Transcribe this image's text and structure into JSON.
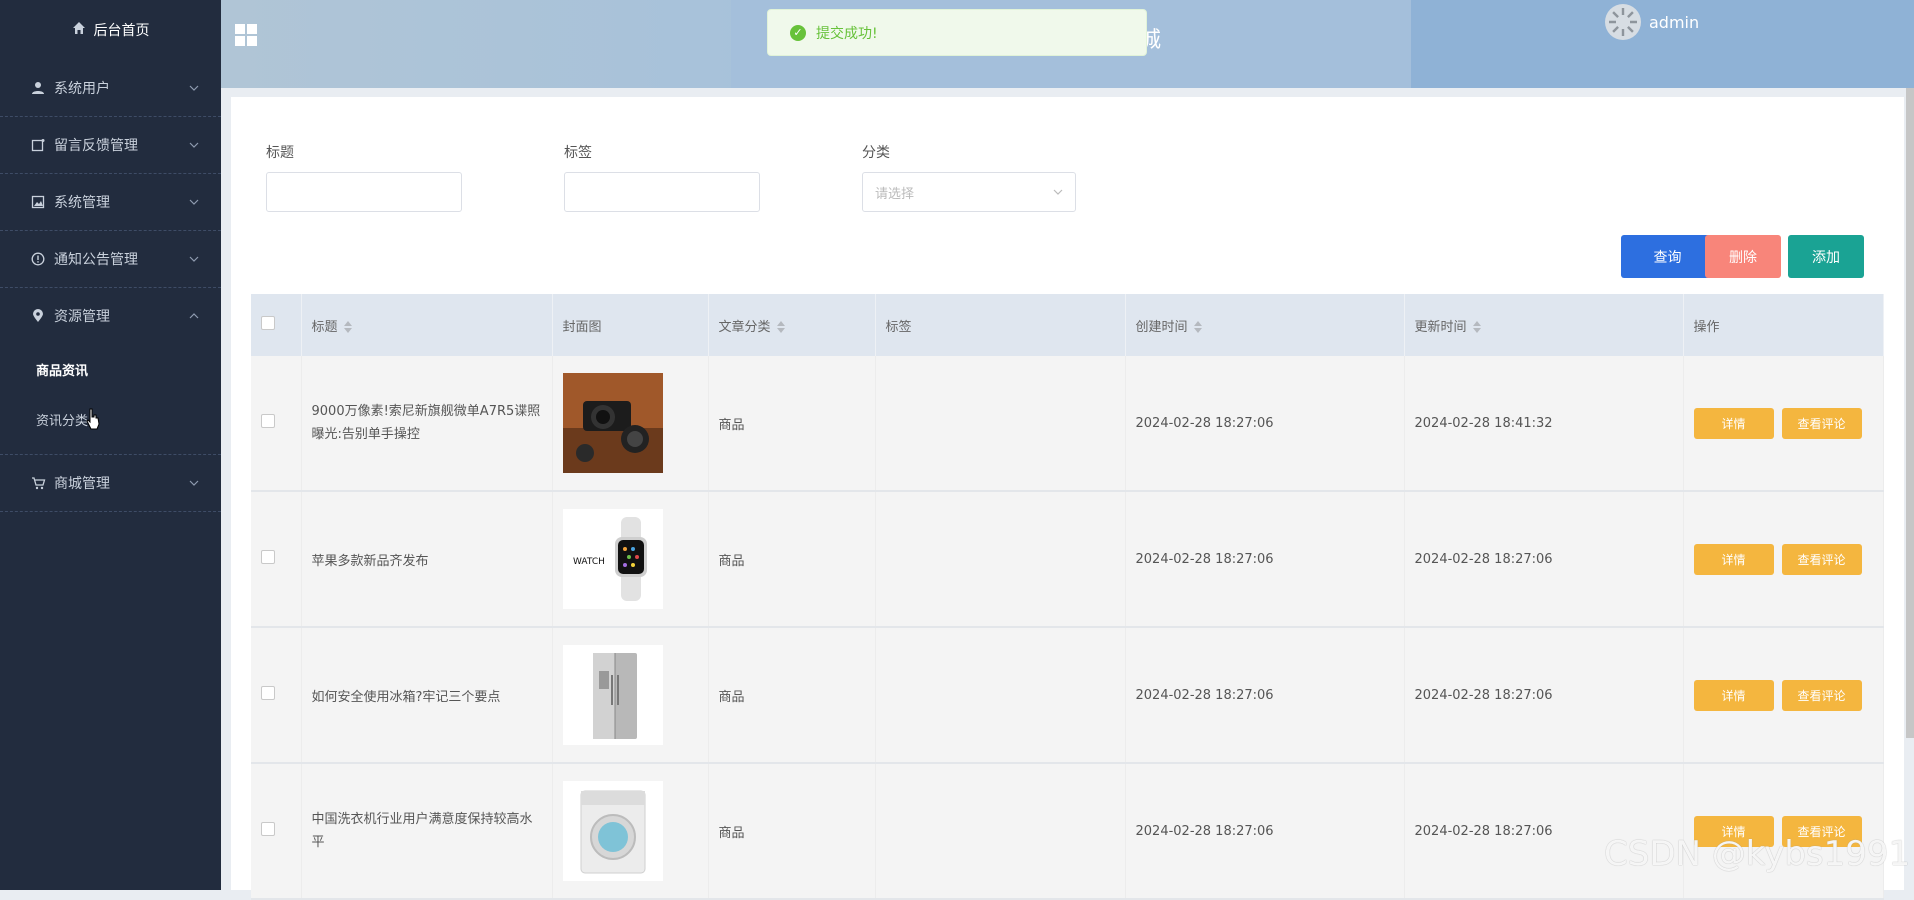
{
  "sidebar": {
    "home": "后台首页",
    "groups": [
      {
        "label": "系统用户"
      },
      {
        "label": "留言反馈管理"
      },
      {
        "label": "系统管理"
      },
      {
        "label": "通知公告管理"
      },
      {
        "label": "资源管理"
      },
      {
        "label": "商城管理"
      }
    ],
    "sub_items": [
      "商品资讯",
      "资讯分类"
    ]
  },
  "header": {
    "title_fragment": "城",
    "user": "admin",
    "toast": "提交成功!"
  },
  "filters": {
    "title_label": "标题",
    "tag_label": "标签",
    "category_label": "分类",
    "category_placeholder": "请选择"
  },
  "buttons": {
    "query": "查询",
    "delete": "删除",
    "add": "添加"
  },
  "colors": {
    "query": "#2d6fe0",
    "delete": "#f8857a",
    "add": "#1aa394",
    "op": "#f4b63f"
  },
  "table": {
    "headers": [
      "标题",
      "封面图",
      "文章分类",
      "标签",
      "创建时间",
      "更新时间",
      "操作"
    ],
    "detail_label": "详情",
    "comment_label": "查看评论",
    "rows": [
      {
        "title": "9000万像素!索尼新旗舰微单A7R5谍照曝光:告别单手操控",
        "category": "商品",
        "tags": "",
        "created": "2024-02-28 18:27:06",
        "updated": "2024-02-28 18:41:32",
        "cover": "camera-photo"
      },
      {
        "title": "苹果多款新品齐发布",
        "category": "商品",
        "tags": "",
        "created": "2024-02-28 18:27:06",
        "updated": "2024-02-28 18:27:06",
        "cover": "apple-watch-photo"
      },
      {
        "title": "如何安全使用冰箱?牢记三个要点",
        "category": "商品",
        "tags": "",
        "created": "2024-02-28 18:27:06",
        "updated": "2024-02-28 18:27:06",
        "cover": "fridge-photo"
      },
      {
        "title": "中国洗衣机行业用户满意度保持较高水平",
        "category": "商品",
        "tags": "",
        "created": "2024-02-28 18:27:06",
        "updated": "2024-02-28 18:27:06",
        "cover": "washer-photo"
      }
    ]
  },
  "watermark": "CSDN @kybs1991"
}
